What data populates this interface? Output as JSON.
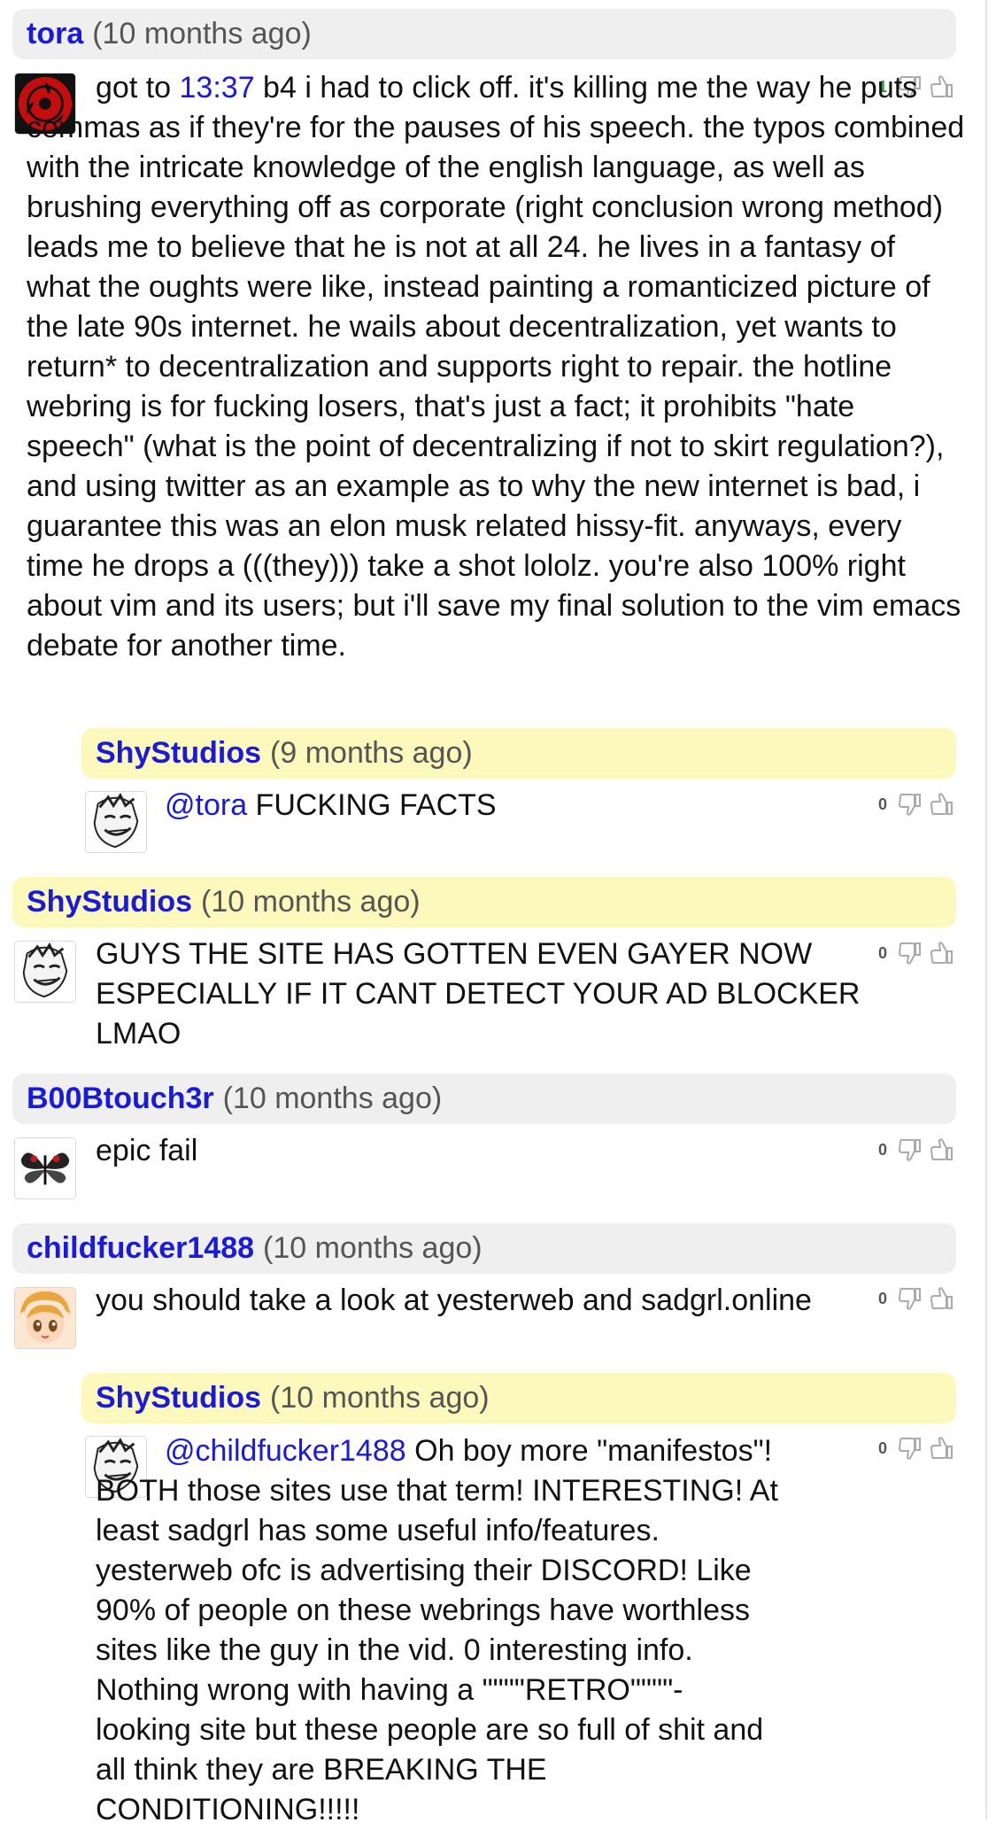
{
  "comments": [
    {
      "user": "tora",
      "age": "(10 months ago)",
      "score": "1",
      "text_link": "13:37",
      "text_first": "got to ",
      "text_rest": " b4 i had to click off. it's killing me the way he puts commas as if they're for the pauses of his speech. the typos combined with the intricate knowledge of the english language, as well as brushing everything off as corporate (right conclusion wrong method) leads me to believe that he is not at all 24. he lives in a fantasy of what the oughts were like, instead painting a romanticized picture of the late 90s internet. he wails about decentralization, yet wants to return* to decentralization and supports right to repair. the hotline webring is for fucking losers, that's just a fact; it prohibits \"hate speech\" (what is the point of decentralizing if not to skirt regulation?), and using twitter as an example as to why the new internet is bad, i guarantee this was an elon musk related hissy-fit. anyways, every time he drops a (((they))) take a shot lololz. you're also 100% right about vim and its users; but i'll save my final solution to the vim emacs debate for another time."
    },
    {
      "user": "ShyStudios",
      "age": "(9 months ago)",
      "score": "0",
      "mention": "@tora",
      "text": " FUCKING FACTS"
    },
    {
      "user": "ShyStudios",
      "age": "(10 months ago)",
      "score": "0",
      "text": "GUYS THE SITE HAS GOTTEN EVEN GAYER NOW ESPECIALLY IF IT CANT DETECT YOUR AD BLOCKER LMAO"
    },
    {
      "user": "B00Btouch3r",
      "age": "(10 months ago)",
      "score": "0",
      "text": "epic fail"
    },
    {
      "user": "childfucker1488",
      "age": "(10 months ago)",
      "score": "0",
      "text": "you should take a look at yesterweb and sadgrl.online"
    },
    {
      "user": "ShyStudios",
      "age": "(10 months ago)",
      "score": "0",
      "mention": "@childfucker1488",
      "text": " Oh boy more \"manifestos\"! BOTH those sites use that term! INTERESTING! At least sadgrl has some useful info/features. yesterweb ofc is advertising their DISCORD! Like 90% of people on these webrings have worthless sites like the guy in the vid. 0 interesting info. Nothing wrong with having a \"\"\"\"RETRO\"\"\"\"- looking site but these people are so full of shit and all think they are BREAKING THE CONDITIONING!!!!!"
    }
  ],
  "colors": {
    "username": "#1a1adf",
    "header_gray": "#efefef",
    "header_yellow": "#fdf9bd",
    "score_green": "#2e9a2e"
  },
  "icons": [
    "thumbs-down-icon",
    "thumbs-up-icon"
  ]
}
